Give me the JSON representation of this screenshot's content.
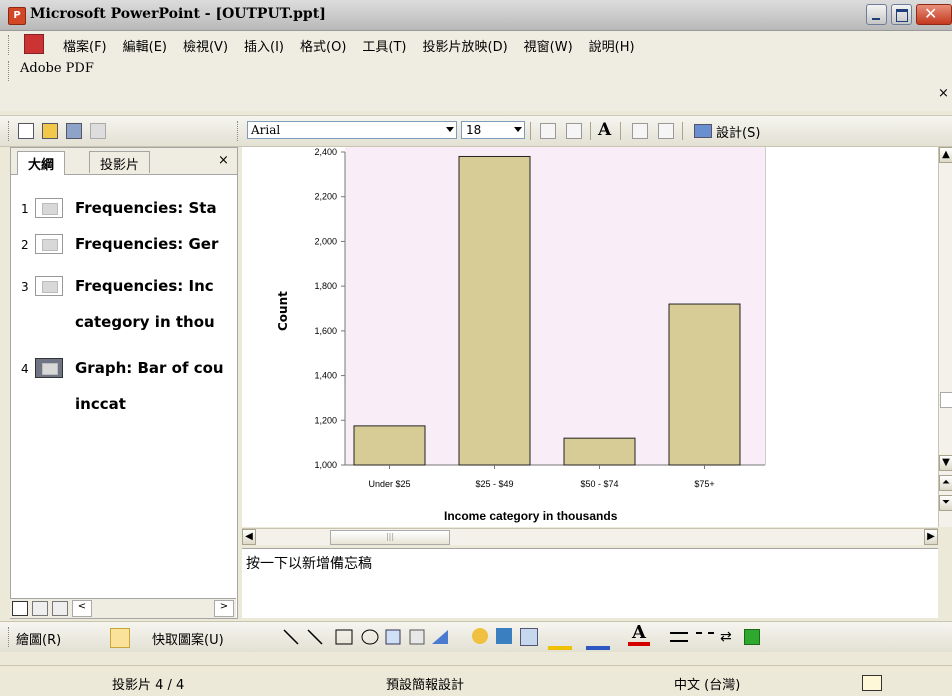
{
  "window": {
    "title": "Microsoft PowerPoint - [OUTPUT.ppt]"
  },
  "menu": {
    "items": [
      "檔案(F)",
      "編輯(E)",
      "檢視(V)",
      "插入(I)",
      "格式(O)",
      "工具(T)",
      "投影片放映(D)",
      "視窗(W)",
      "說明(H)"
    ],
    "adobe": "Adobe PDF",
    "close": "×"
  },
  "toolbar": {
    "font": "Arial",
    "size": "18",
    "design": "設計(S)"
  },
  "outline": {
    "tabs": {
      "outline": "大綱",
      "slides": "投影片",
      "close": "×"
    },
    "slides": [
      {
        "num": "1",
        "line1": "Frequencies: Sta",
        "line2": ""
      },
      {
        "num": "2",
        "line1": "Frequencies: Ger",
        "line2": ""
      },
      {
        "num": "3",
        "line1": "Frequencies: Inc",
        "line2": "category in thou"
      },
      {
        "num": "4",
        "line1": "Graph: Bar of cou",
        "line2": "inccat"
      }
    ]
  },
  "chart_data": {
    "type": "bar",
    "categories": [
      "Under $25",
      "$25 - $49",
      "$50 - $74",
      "$75+"
    ],
    "values": [
      1175,
      2380,
      1120,
      1720
    ],
    "xlabel": "Income category in thousands",
    "ylabel": "Count",
    "ylim": [
      1000,
      2400
    ],
    "yticks": [
      "1,000",
      "1,200",
      "1,400",
      "1,600",
      "1,800",
      "2,000",
      "2,200",
      "2,400"
    ],
    "bar_color": "#d8cc96",
    "plot_bg": "#f9eef7"
  },
  "notes": {
    "placeholder": "按一下以新增備忘稿"
  },
  "drawbar": {
    "draw": "繪圖(R)",
    "autoshape": "快取圖案(U)"
  },
  "status": {
    "slide": "投影片 4 / 4",
    "design": "預設簡報設計",
    "lang": "中文 (台灣)"
  }
}
